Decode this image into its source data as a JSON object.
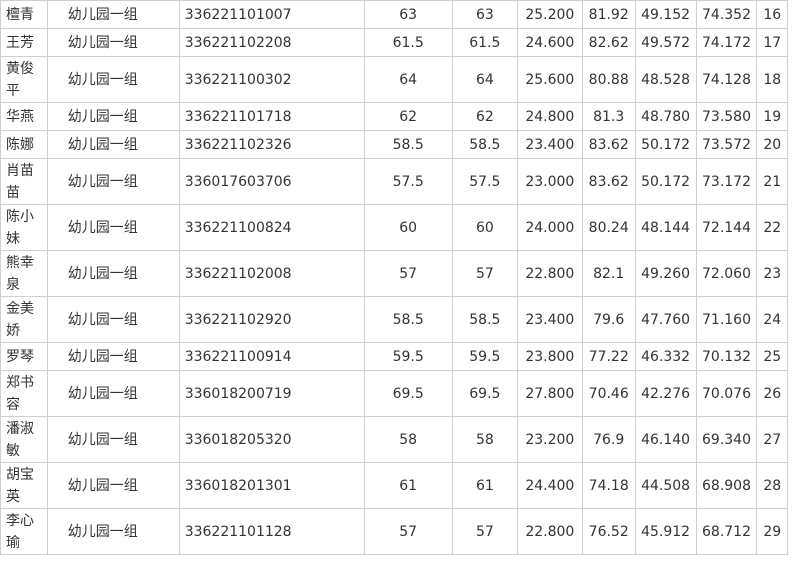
{
  "rows": [
    {
      "name": "檀青",
      "group": "幼儿园一组",
      "id": "336221101007",
      "written": "63",
      "written_score": "63",
      "written_weighted": "25.200",
      "interview": "81.92",
      "interview_weighted": "49.152",
      "total": "74.352",
      "rank": "16"
    },
    {
      "name": "王芳",
      "group": "幼儿园一组",
      "id": "336221102208",
      "written": "61.5",
      "written_score": "61.5",
      "written_weighted": "24.600",
      "interview": "82.62",
      "interview_weighted": "49.572",
      "total": "74.172",
      "rank": "17"
    },
    {
      "name": "黄俊平",
      "group": "幼儿园一组",
      "id": "336221100302",
      "written": "64",
      "written_score": "64",
      "written_weighted": "25.600",
      "interview": "80.88",
      "interview_weighted": "48.528",
      "total": "74.128",
      "rank": "18"
    },
    {
      "name": "华燕",
      "group": "幼儿园一组",
      "id": "336221101718",
      "written": "62",
      "written_score": "62",
      "written_weighted": "24.800",
      "interview": "81.3",
      "interview_weighted": "48.780",
      "total": "73.580",
      "rank": "19"
    },
    {
      "name": "陈娜",
      "group": "幼儿园一组",
      "id": "336221102326",
      "written": "58.5",
      "written_score": "58.5",
      "written_weighted": "23.400",
      "interview": "83.62",
      "interview_weighted": "50.172",
      "total": "73.572",
      "rank": "20"
    },
    {
      "name": "肖苗苗",
      "group": "幼儿园一组",
      "id": "336017603706",
      "written": "57.5",
      "written_score": "57.5",
      "written_weighted": "23.000",
      "interview": "83.62",
      "interview_weighted": "50.172",
      "total": "73.172",
      "rank": "21"
    },
    {
      "name": "陈小妹",
      "group": "幼儿园一组",
      "id": "336221100824",
      "written": "60",
      "written_score": "60",
      "written_weighted": "24.000",
      "interview": "80.24",
      "interview_weighted": "48.144",
      "total": "72.144",
      "rank": "22"
    },
    {
      "name": "熊幸泉",
      "group": "幼儿园一组",
      "id": "336221102008",
      "written": "57",
      "written_score": "57",
      "written_weighted": "22.800",
      "interview": "82.1",
      "interview_weighted": "49.260",
      "total": "72.060",
      "rank": "23"
    },
    {
      "name": "金美娇",
      "group": "幼儿园一组",
      "id": "336221102920",
      "written": "58.5",
      "written_score": "58.5",
      "written_weighted": "23.400",
      "interview": "79.6",
      "interview_weighted": "47.760",
      "total": "71.160",
      "rank": "24"
    },
    {
      "name": "罗琴",
      "group": "幼儿园一组",
      "id": "336221100914",
      "written": "59.5",
      "written_score": "59.5",
      "written_weighted": "23.800",
      "interview": "77.22",
      "interview_weighted": "46.332",
      "total": "70.132",
      "rank": "25"
    },
    {
      "name": "郑书容",
      "group": "幼儿园一组",
      "id": "336018200719",
      "written": "69.5",
      "written_score": "69.5",
      "written_weighted": "27.800",
      "interview": "70.46",
      "interview_weighted": "42.276",
      "total": "70.076",
      "rank": "26"
    },
    {
      "name": "潘淑敏",
      "group": "幼儿园一组",
      "id": "336018205320",
      "written": "58",
      "written_score": "58",
      "written_weighted": "23.200",
      "interview": "76.9",
      "interview_weighted": "46.140",
      "total": "69.340",
      "rank": "27"
    },
    {
      "name": "胡宝英",
      "group": "幼儿园一组",
      "id": "336018201301",
      "written": "61",
      "written_score": "61",
      "written_weighted": "24.400",
      "interview": "74.18",
      "interview_weighted": "44.508",
      "total": "68.908",
      "rank": "28"
    },
    {
      "name": "李心瑜",
      "group": "幼儿园一组",
      "id": "336221101128",
      "written": "57",
      "written_score": "57",
      "written_weighted": "22.800",
      "interview": "76.52",
      "interview_weighted": "45.912",
      "total": "68.712",
      "rank": "29"
    }
  ]
}
